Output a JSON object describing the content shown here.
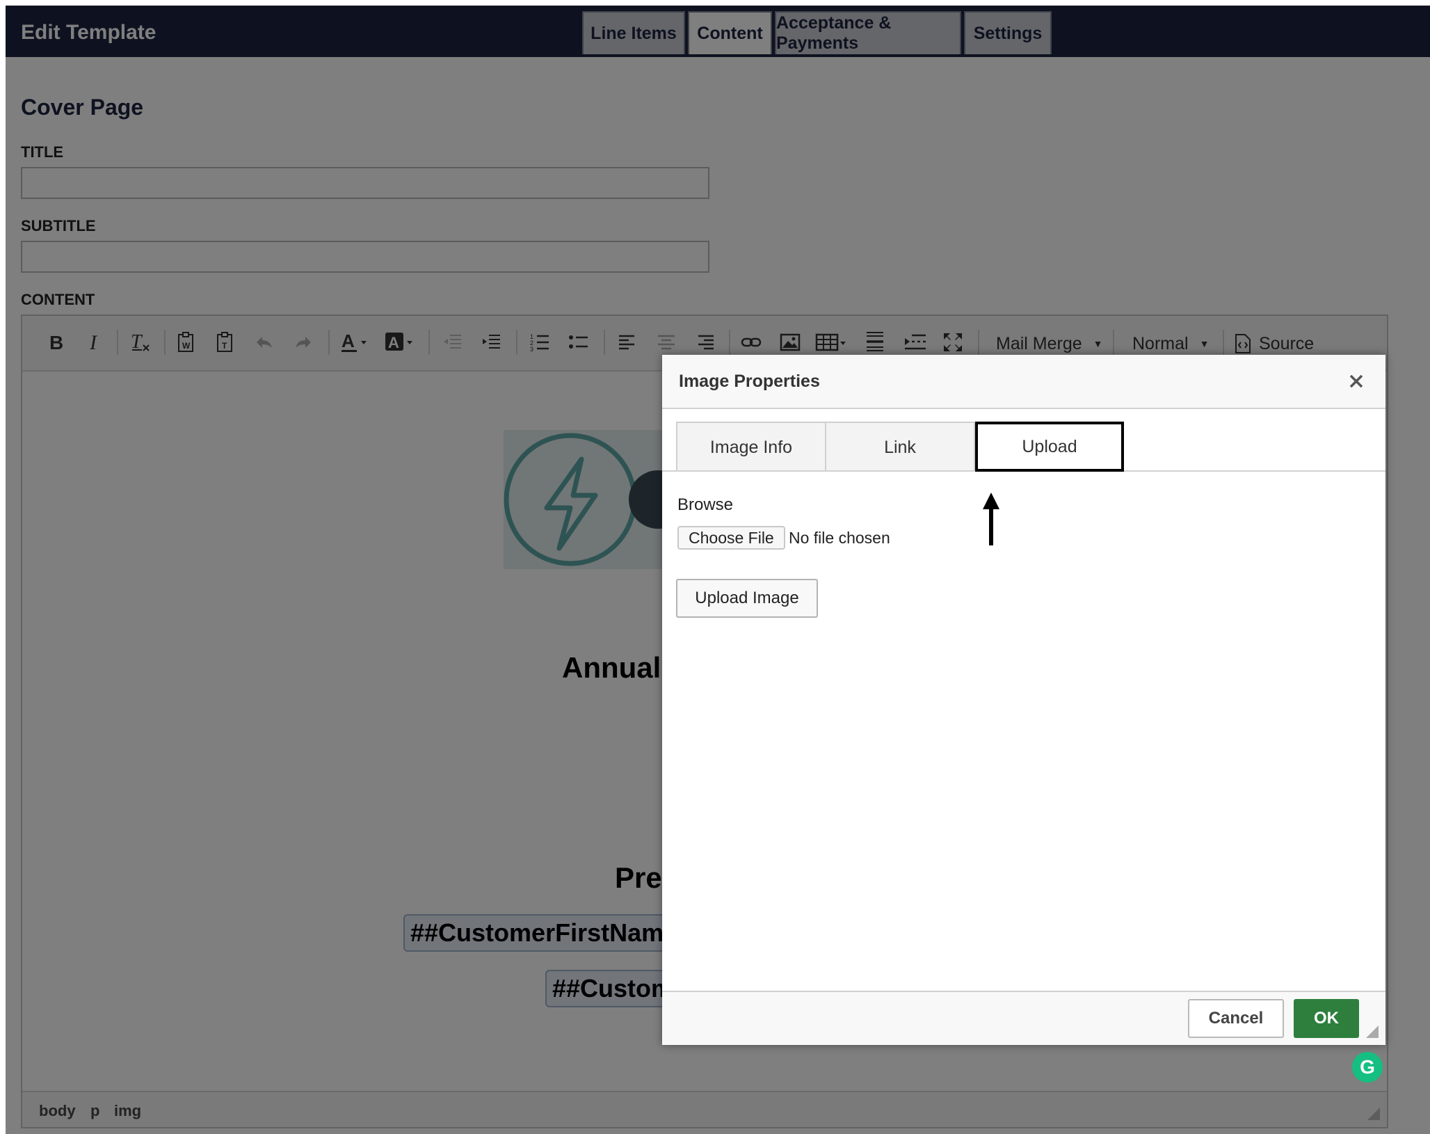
{
  "header": {
    "title": "Edit Template",
    "tabs": [
      {
        "label": "Line Items"
      },
      {
        "label": "Content"
      },
      {
        "label": "Acceptance & Payments"
      },
      {
        "label": "Settings"
      }
    ],
    "active_tab": "Content"
  },
  "cover_page": {
    "heading": "Cover Page",
    "title_label": "TITLE",
    "title_value": "",
    "subtitle_label": "SUBTITLE",
    "subtitle_value": "",
    "content_label": "CONTENT"
  },
  "toolbar": {
    "mail_merge_label": "Mail Merge",
    "format_label": "Normal",
    "source_label": "Source"
  },
  "document": {
    "heading_fragment": "Annual",
    "subheading_fragment": "Pre",
    "merge_tag_1": "##CustomerFirstName",
    "merge_tag_2": "##Custom"
  },
  "status_bar": {
    "path": [
      "body",
      "p",
      "img"
    ]
  },
  "dialog": {
    "title": "Image Properties",
    "tabs": [
      {
        "label": "Image Info"
      },
      {
        "label": "Link"
      },
      {
        "label": "Upload"
      }
    ],
    "active_tab": "Upload",
    "browse_label": "Browse",
    "choose_file_label": "Choose File",
    "file_status": "No file chosen",
    "upload_button_label": "Upload Image",
    "cancel_label": "Cancel",
    "ok_label": "OK"
  },
  "colors": {
    "header_bg": "#1c2540",
    "ok_button": "#2e7f3e",
    "grammarly_badge": "#15bf81"
  },
  "icons": [
    "close-icon",
    "bold-icon",
    "italic-icon",
    "remove-format-icon",
    "paste-word-icon",
    "paste-text-icon",
    "undo-icon",
    "redo-icon",
    "text-color-icon",
    "background-color-icon",
    "outdent-icon",
    "indent-icon",
    "numbered-list-icon",
    "bulleted-list-icon",
    "align-left-icon",
    "align-center-icon",
    "align-right-icon",
    "link-icon",
    "image-icon",
    "table-icon",
    "horizontal-rule-icon",
    "page-break-icon",
    "maximize-icon",
    "source-icon",
    "up-arrow-icon",
    "grammarly-icon"
  ]
}
